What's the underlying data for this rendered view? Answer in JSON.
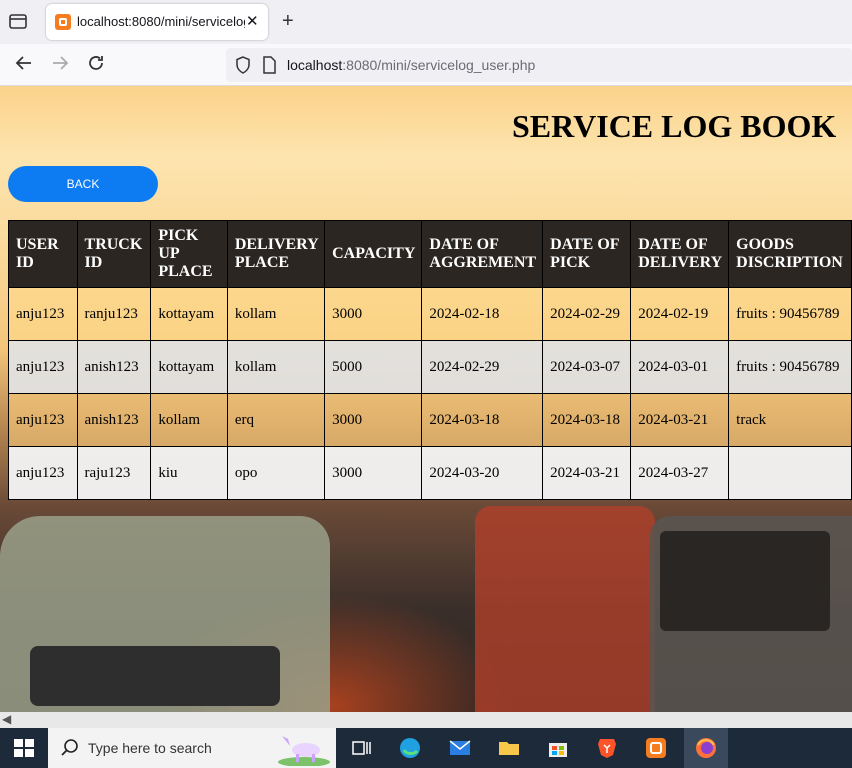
{
  "browser": {
    "tab_title": "localhost:8080/mini/servicelog_user.php",
    "tab_close": "✕",
    "new_tab": "+",
    "url_host": "localhost",
    "url_rest": ":8080/mini/servicelog_user.php"
  },
  "page": {
    "heading": "SERVICE LOG BOOK",
    "back_label": "BACK"
  },
  "table": {
    "headers": [
      "USER ID",
      "TRUCK ID",
      "PICK UP PLACE",
      "DELIVERY PLACE",
      "CAPACITY",
      "DATE OF AGGREMENT",
      "DATE OF PICK",
      "DATE OF DELIVERY",
      "GOODS DISCRIPTION"
    ],
    "rows": [
      [
        "anju123",
        "ranju123",
        "kottayam",
        "kollam",
        "3000",
        "2024-02-18",
        "2024-02-29",
        "2024-02-19",
        "fruits : 90456789"
      ],
      [
        "anju123",
        "anish123",
        "kottayam",
        "kollam",
        "5000",
        "2024-02-29",
        "2024-03-07",
        "2024-03-01",
        "fruits : 90456789"
      ],
      [
        "anju123",
        "anish123",
        "kollam",
        "erq",
        "3000",
        "2024-03-18",
        "2024-03-18",
        "2024-03-21",
        "track"
      ],
      [
        "anju123",
        "raju123",
        "kiu",
        "opo",
        "3000",
        "2024-03-20",
        "2024-03-21",
        "2024-03-27",
        ""
      ]
    ]
  },
  "taskbar": {
    "search_placeholder": "Type here to search",
    "icons": [
      "task-view-icon",
      "edge-icon",
      "mail-icon",
      "file-explorer-icon",
      "store-icon",
      "brave-icon",
      "xampp-icon",
      "firefox-icon"
    ]
  },
  "colors": {
    "back_button": "#0d7bf2",
    "header_bg": "#2c2622"
  }
}
